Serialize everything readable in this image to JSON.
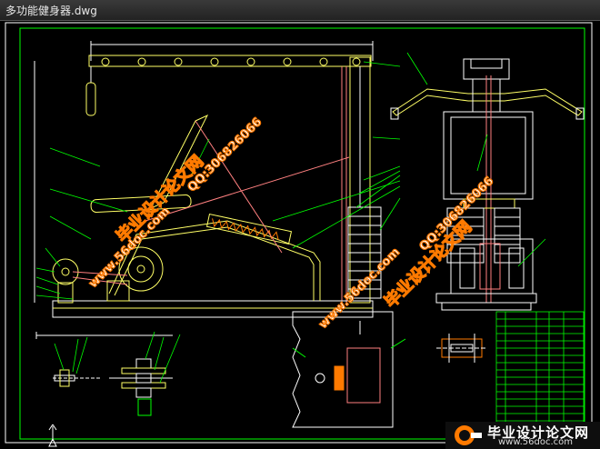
{
  "window": {
    "title": "多功能健身器.dwg"
  },
  "watermarks": {
    "site_cn": "毕业设计论文网",
    "site_url": "www.56doc.com",
    "qq": "QQ:306826066"
  },
  "banner": {
    "cn": "毕业设计论文网",
    "url": "www.56doc.com"
  },
  "colors": {
    "background": "#000000",
    "frame": "#ffffff",
    "border": "#00ff00",
    "machine": "#ffff66",
    "watermark_orange": "#ff7a00",
    "watermark_fill": "#fff200",
    "leader": "#00ff00",
    "pink": "#ff8080"
  }
}
